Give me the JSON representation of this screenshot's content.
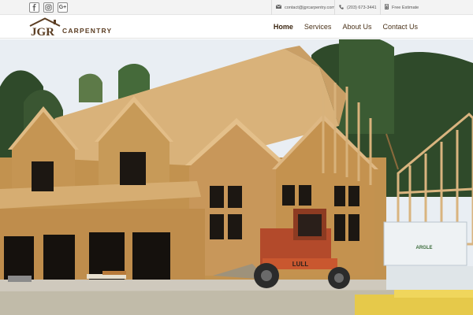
{
  "social": {
    "facebook_icon": "facebook-icon",
    "instagram_icon": "instagram-icon",
    "googleplus_icon": "googleplus-icon",
    "googleplus_text": "G+"
  },
  "contact": {
    "email": "contact@jgrcarpentry.com",
    "phone": "(203) 673-3441",
    "estimate_label": "Free Estimate"
  },
  "logo": {
    "initials": "JGR",
    "word": "CARPENTRY"
  },
  "nav": {
    "home": "Home",
    "services": "Services",
    "about": "About Us",
    "contact": "Contact Us"
  },
  "hero": {
    "loader_sign": "LULL",
    "brand_wrap_text": "ARGLE"
  },
  "colors": {
    "accent_brown": "#5b3d22",
    "plywood": "#d9b27a",
    "sheathing": "#c2924f",
    "sky": "#e9eef3",
    "trees": "#2f4a2a",
    "loader": "#b34a2b"
  }
}
